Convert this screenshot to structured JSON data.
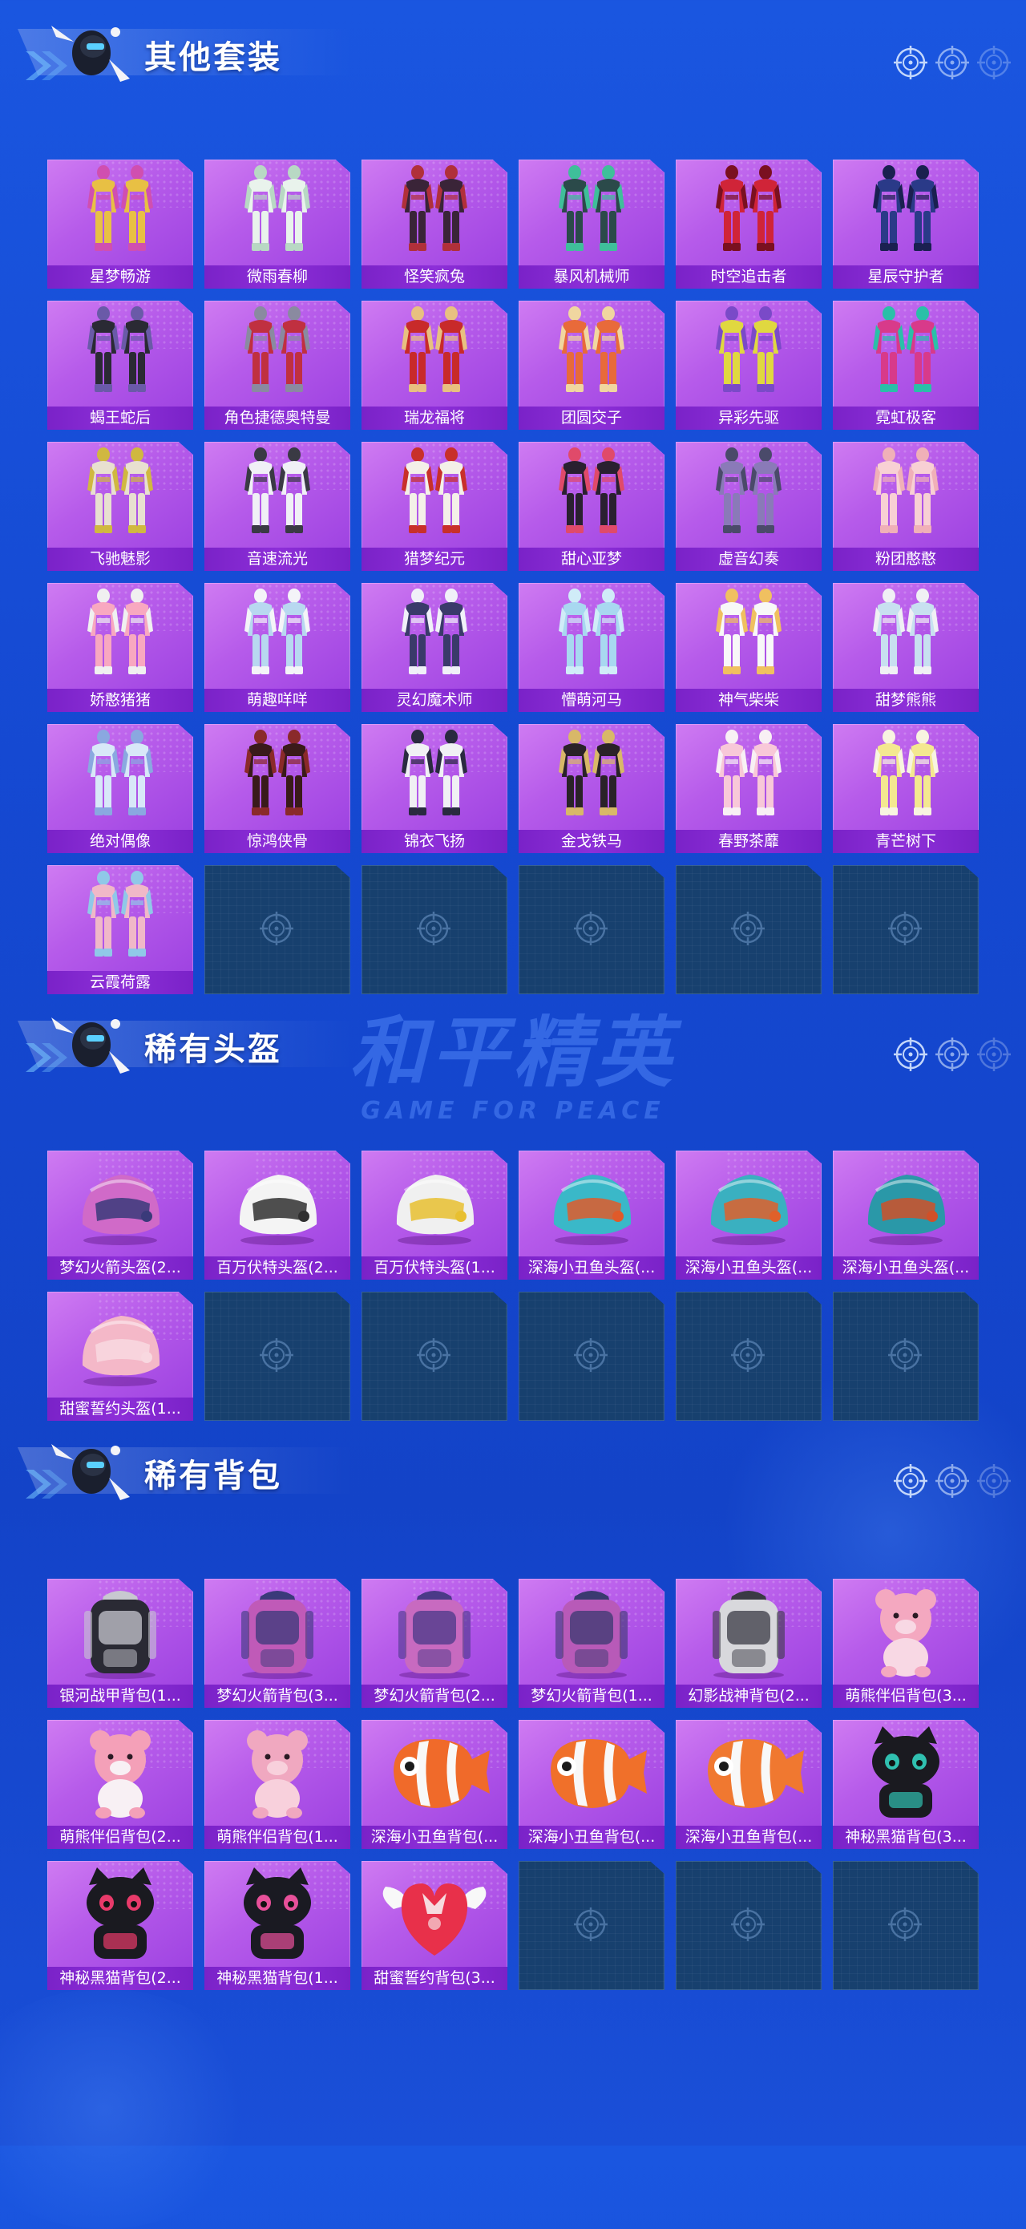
{
  "watermark": {
    "cn": "和平精英",
    "en": "GAME FOR PEACE"
  },
  "sections": [
    {
      "title": "其他套装",
      "items": [
        {
          "label": "星梦畅游",
          "kind": "suit",
          "colors": [
            "#e8c044",
            "#d04fb0"
          ]
        },
        {
          "label": "微雨春柳",
          "kind": "suit",
          "colors": [
            "#e9f3ec",
            "#b8d8c4"
          ]
        },
        {
          "label": "怪笑疯兔",
          "kind": "suit",
          "colors": [
            "#3a2438",
            "#b0303a"
          ]
        },
        {
          "label": "暴风机械师",
          "kind": "suit",
          "colors": [
            "#2b4a4a",
            "#3fbf9a"
          ]
        },
        {
          "label": "时空追击者",
          "kind": "suit",
          "colors": [
            "#d02438",
            "#7a1020"
          ]
        },
        {
          "label": "星辰守护者",
          "kind": "suit",
          "colors": [
            "#2a3a88",
            "#1a2050"
          ]
        },
        {
          "label": "蝎王蛇后",
          "kind": "suit",
          "colors": [
            "#2a2a34",
            "#6a5aa8"
          ]
        },
        {
          "label": "角色捷德奥特曼",
          "kind": "suit",
          "colors": [
            "#c03040",
            "#8a8aa0"
          ]
        },
        {
          "label": "瑞龙福将",
          "kind": "suit",
          "colors": [
            "#c82a2a",
            "#e8c080"
          ]
        },
        {
          "label": "团圆交子",
          "kind": "suit",
          "colors": [
            "#e86a3a",
            "#f0d6a0"
          ]
        },
        {
          "label": "异彩先驱",
          "kind": "suit",
          "colors": [
            "#e0d840",
            "#7a4ac8"
          ]
        },
        {
          "label": "霓虹极客",
          "kind": "suit",
          "colors": [
            "#d83a8a",
            "#2ac0a8"
          ]
        },
        {
          "label": "飞驰魅影",
          "kind": "suit",
          "colors": [
            "#e8e0d0",
            "#d0b840"
          ]
        },
        {
          "label": "音速流光",
          "kind": "suit",
          "colors": [
            "#f0f0f6",
            "#3a3a44"
          ]
        },
        {
          "label": "猎梦纪元",
          "kind": "suit",
          "colors": [
            "#f4f0e8",
            "#c8302a"
          ]
        },
        {
          "label": "甜心亚梦",
          "kind": "suit",
          "colors": [
            "#2a2030",
            "#e04a6a"
          ]
        },
        {
          "label": "虚音幻奏",
          "kind": "suit",
          "colors": [
            "#8a7ab8",
            "#4a4a6a"
          ]
        },
        {
          "label": "粉团憨憨",
          "kind": "suit",
          "colors": [
            "#f8d0d4",
            "#f0b0b8"
          ]
        },
        {
          "label": "娇憨猪猪",
          "kind": "suit",
          "colors": [
            "#f8a8c0",
            "#f0f0f0"
          ]
        },
        {
          "label": "萌趣咩咩",
          "kind": "suit",
          "colors": [
            "#b8d8f0",
            "#f4f4f8"
          ]
        },
        {
          "label": "灵幻魔术师",
          "kind": "suit",
          "colors": [
            "#3a3a6a",
            "#f0f0f8"
          ]
        },
        {
          "label": "懵萌河马",
          "kind": "suit",
          "colors": [
            "#a8d8f0",
            "#d0ecf8"
          ]
        },
        {
          "label": "神气柴柴",
          "kind": "suit",
          "colors": [
            "#f8f8f8",
            "#f0c060"
          ]
        },
        {
          "label": "甜梦熊熊",
          "kind": "suit",
          "colors": [
            "#c8e0f0",
            "#f0f0f4"
          ]
        },
        {
          "label": "绝对偶像",
          "kind": "suit",
          "colors": [
            "#d8e8f8",
            "#8aa8e0"
          ]
        },
        {
          "label": "惊鸿侠骨",
          "kind": "suit",
          "colors": [
            "#3a1a1a",
            "#8a2a2a"
          ]
        },
        {
          "label": "锦衣飞扬",
          "kind": "suit",
          "colors": [
            "#f0f0f4",
            "#2a2a40"
          ]
        },
        {
          "label": "金戈铁马",
          "kind": "suit",
          "colors": [
            "#2a2228",
            "#d8b868"
          ]
        },
        {
          "label": "春野茶蘼",
          "kind": "suit",
          "colors": [
            "#f8c8d8",
            "#f8f0f4"
          ]
        },
        {
          "label": "青芒树下",
          "kind": "suit",
          "colors": [
            "#f4e890",
            "#f8f4e0"
          ]
        },
        {
          "label": "云霞荷露",
          "kind": "suit",
          "colors": [
            "#f0b8c8",
            "#90c8e8"
          ]
        }
      ],
      "empty_slots": 5
    },
    {
      "title": "稀有头盔",
      "items": [
        {
          "label": "梦幻火箭头盔(2...",
          "kind": "helmet",
          "colors": [
            "#d06ac8",
            "#3a3a7a"
          ]
        },
        {
          "label": "百万伏特头盔(2...",
          "kind": "helmet",
          "colors": [
            "#f4f4f4",
            "#303030"
          ]
        },
        {
          "label": "百万伏特头盔(1...",
          "kind": "helmet",
          "colors": [
            "#f0f0f0",
            "#e8c030"
          ]
        },
        {
          "label": "深海小丑鱼头盔(...",
          "kind": "helmet",
          "colors": [
            "#3ab8c8",
            "#e05a2a"
          ]
        },
        {
          "label": "深海小丑鱼头盔(...",
          "kind": "helmet",
          "colors": [
            "#3ab0c0",
            "#e0602a"
          ]
        },
        {
          "label": "深海小丑鱼头盔(...",
          "kind": "helmet",
          "colors": [
            "#2a98a8",
            "#d05028"
          ]
        },
        {
          "label": "甜蜜誓约头盔(1...",
          "kind": "helmet",
          "colors": [
            "#f4b8c8",
            "#f8d8e0"
          ]
        }
      ],
      "empty_slots": 5
    },
    {
      "title": "稀有背包",
      "items": [
        {
          "label": "银河战甲背包(1...",
          "kind": "backpack",
          "colors": [
            "#2a2a34",
            "#c8c8d0"
          ]
        },
        {
          "label": "梦幻火箭背包(3...",
          "kind": "backpack",
          "colors": [
            "#c05ab8",
            "#3a3a7a"
          ]
        },
        {
          "label": "梦幻火箭背包(2...",
          "kind": "backpack",
          "colors": [
            "#c86ac0",
            "#4a3a88"
          ]
        },
        {
          "label": "梦幻火箭背包(1...",
          "kind": "backpack",
          "colors": [
            "#b85ab8",
            "#3a3a70"
          ]
        },
        {
          "label": "幻影战神背包(2...",
          "kind": "backpack",
          "colors": [
            "#d8d8dc",
            "#3a3a44"
          ]
        },
        {
          "label": "萌熊伴侣背包(3...",
          "kind": "bear",
          "colors": [
            "#f4a8c0",
            "#f8d8e4"
          ]
        },
        {
          "label": "萌熊伴侣背包(2...",
          "kind": "bear",
          "colors": [
            "#f4a0b8",
            "#f8f0f4"
          ]
        },
        {
          "label": "萌熊伴侣背包(1...",
          "kind": "bear",
          "colors": [
            "#f0a8c0",
            "#f8d0dc"
          ]
        },
        {
          "label": "深海小丑鱼背包(...",
          "kind": "fish",
          "colors": [
            "#f06a2a",
            "#f8f8f8"
          ]
        },
        {
          "label": "深海小丑鱼背包(...",
          "kind": "fish",
          "colors": [
            "#f0702a",
            "#f8f8f8"
          ]
        },
        {
          "label": "深海小丑鱼背包(...",
          "kind": "fish",
          "colors": [
            "#f07830",
            "#f8f8f8"
          ]
        },
        {
          "label": "神秘黑猫背包(3...",
          "kind": "cat",
          "colors": [
            "#1a1a20",
            "#30c0b0"
          ]
        },
        {
          "label": "神秘黑猫背包(2...",
          "kind": "cat",
          "colors": [
            "#1a1a20",
            "#e83a6a"
          ]
        },
        {
          "label": "神秘黑猫背包(1...",
          "kind": "cat",
          "colors": [
            "#1a1a22",
            "#e8509a"
          ]
        },
        {
          "label": "甜蜜誓约背包(3...",
          "kind": "heart",
          "colors": [
            "#e8304a",
            "#f8f8f8"
          ]
        }
      ],
      "empty_slots": 3
    }
  ]
}
